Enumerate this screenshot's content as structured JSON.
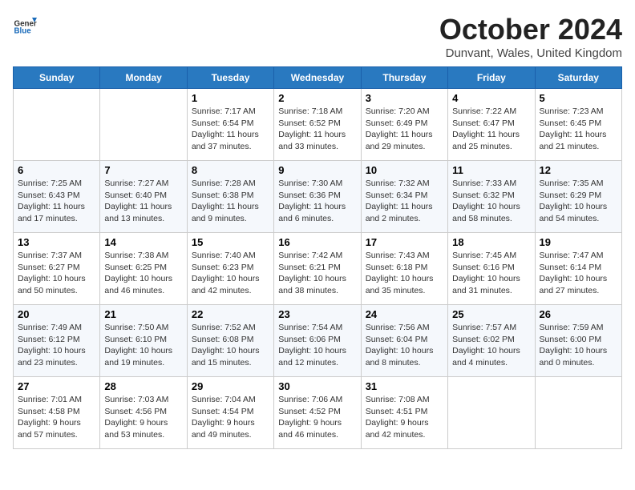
{
  "header": {
    "logo_general": "General",
    "logo_blue": "Blue",
    "title": "October 2024",
    "location": "Dunvant, Wales, United Kingdom"
  },
  "days": [
    "Sunday",
    "Monday",
    "Tuesday",
    "Wednesday",
    "Thursday",
    "Friday",
    "Saturday"
  ],
  "weeks": [
    [
      {
        "date": "",
        "info": ""
      },
      {
        "date": "",
        "info": ""
      },
      {
        "date": "1",
        "info": "Sunrise: 7:17 AM\nSunset: 6:54 PM\nDaylight: 11 hours and 37 minutes."
      },
      {
        "date": "2",
        "info": "Sunrise: 7:18 AM\nSunset: 6:52 PM\nDaylight: 11 hours and 33 minutes."
      },
      {
        "date": "3",
        "info": "Sunrise: 7:20 AM\nSunset: 6:49 PM\nDaylight: 11 hours and 29 minutes."
      },
      {
        "date": "4",
        "info": "Sunrise: 7:22 AM\nSunset: 6:47 PM\nDaylight: 11 hours and 25 minutes."
      },
      {
        "date": "5",
        "info": "Sunrise: 7:23 AM\nSunset: 6:45 PM\nDaylight: 11 hours and 21 minutes."
      }
    ],
    [
      {
        "date": "6",
        "info": "Sunrise: 7:25 AM\nSunset: 6:43 PM\nDaylight: 11 hours and 17 minutes."
      },
      {
        "date": "7",
        "info": "Sunrise: 7:27 AM\nSunset: 6:40 PM\nDaylight: 11 hours and 13 minutes."
      },
      {
        "date": "8",
        "info": "Sunrise: 7:28 AM\nSunset: 6:38 PM\nDaylight: 11 hours and 9 minutes."
      },
      {
        "date": "9",
        "info": "Sunrise: 7:30 AM\nSunset: 6:36 PM\nDaylight: 11 hours and 6 minutes."
      },
      {
        "date": "10",
        "info": "Sunrise: 7:32 AM\nSunset: 6:34 PM\nDaylight: 11 hours and 2 minutes."
      },
      {
        "date": "11",
        "info": "Sunrise: 7:33 AM\nSunset: 6:32 PM\nDaylight: 10 hours and 58 minutes."
      },
      {
        "date": "12",
        "info": "Sunrise: 7:35 AM\nSunset: 6:29 PM\nDaylight: 10 hours and 54 minutes."
      }
    ],
    [
      {
        "date": "13",
        "info": "Sunrise: 7:37 AM\nSunset: 6:27 PM\nDaylight: 10 hours and 50 minutes."
      },
      {
        "date": "14",
        "info": "Sunrise: 7:38 AM\nSunset: 6:25 PM\nDaylight: 10 hours and 46 minutes."
      },
      {
        "date": "15",
        "info": "Sunrise: 7:40 AM\nSunset: 6:23 PM\nDaylight: 10 hours and 42 minutes."
      },
      {
        "date": "16",
        "info": "Sunrise: 7:42 AM\nSunset: 6:21 PM\nDaylight: 10 hours and 38 minutes."
      },
      {
        "date": "17",
        "info": "Sunrise: 7:43 AM\nSunset: 6:18 PM\nDaylight: 10 hours and 35 minutes."
      },
      {
        "date": "18",
        "info": "Sunrise: 7:45 AM\nSunset: 6:16 PM\nDaylight: 10 hours and 31 minutes."
      },
      {
        "date": "19",
        "info": "Sunrise: 7:47 AM\nSunset: 6:14 PM\nDaylight: 10 hours and 27 minutes."
      }
    ],
    [
      {
        "date": "20",
        "info": "Sunrise: 7:49 AM\nSunset: 6:12 PM\nDaylight: 10 hours and 23 minutes."
      },
      {
        "date": "21",
        "info": "Sunrise: 7:50 AM\nSunset: 6:10 PM\nDaylight: 10 hours and 19 minutes."
      },
      {
        "date": "22",
        "info": "Sunrise: 7:52 AM\nSunset: 6:08 PM\nDaylight: 10 hours and 15 minutes."
      },
      {
        "date": "23",
        "info": "Sunrise: 7:54 AM\nSunset: 6:06 PM\nDaylight: 10 hours and 12 minutes."
      },
      {
        "date": "24",
        "info": "Sunrise: 7:56 AM\nSunset: 6:04 PM\nDaylight: 10 hours and 8 minutes."
      },
      {
        "date": "25",
        "info": "Sunrise: 7:57 AM\nSunset: 6:02 PM\nDaylight: 10 hours and 4 minutes."
      },
      {
        "date": "26",
        "info": "Sunrise: 7:59 AM\nSunset: 6:00 PM\nDaylight: 10 hours and 0 minutes."
      }
    ],
    [
      {
        "date": "27",
        "info": "Sunrise: 7:01 AM\nSunset: 4:58 PM\nDaylight: 9 hours and 57 minutes."
      },
      {
        "date": "28",
        "info": "Sunrise: 7:03 AM\nSunset: 4:56 PM\nDaylight: 9 hours and 53 minutes."
      },
      {
        "date": "29",
        "info": "Sunrise: 7:04 AM\nSunset: 4:54 PM\nDaylight: 9 hours and 49 minutes."
      },
      {
        "date": "30",
        "info": "Sunrise: 7:06 AM\nSunset: 4:52 PM\nDaylight: 9 hours and 46 minutes."
      },
      {
        "date": "31",
        "info": "Sunrise: 7:08 AM\nSunset: 4:51 PM\nDaylight: 9 hours and 42 minutes."
      },
      {
        "date": "",
        "info": ""
      },
      {
        "date": "",
        "info": ""
      }
    ]
  ]
}
